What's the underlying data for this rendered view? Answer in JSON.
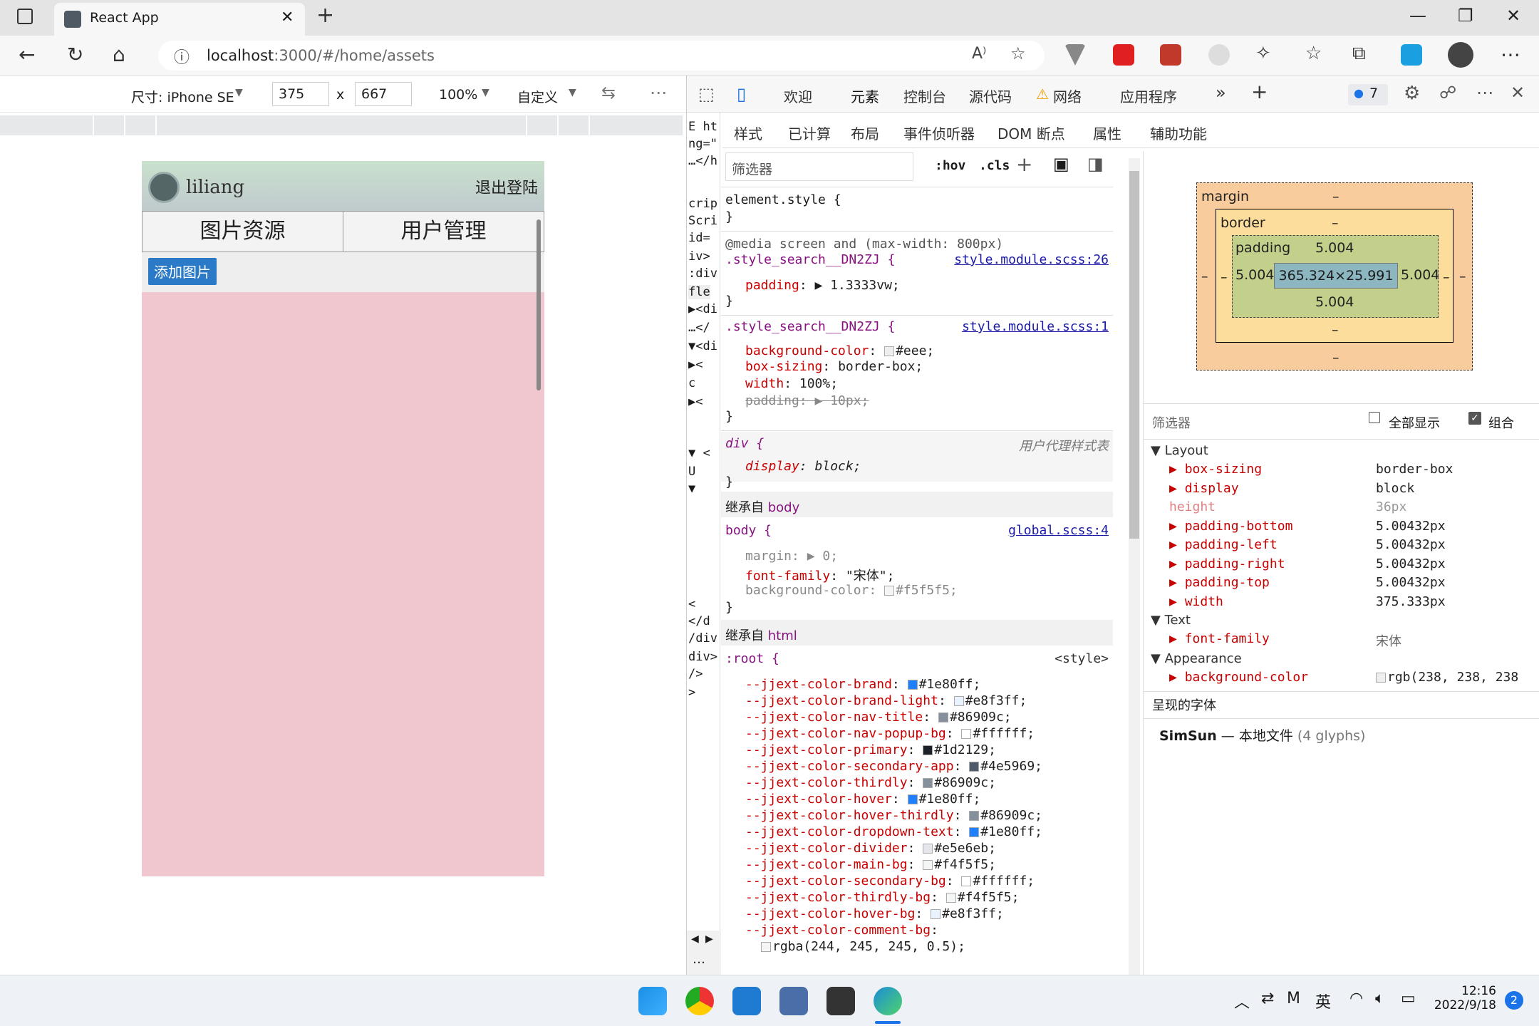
{
  "browser": {
    "tab_title": "React App",
    "tab_close": "✕",
    "new_tab": "+",
    "url_host": "localhost",
    "url_rest": ":3000/#/home/assets"
  },
  "device_toolbar": {
    "device_label": "尺寸: iPhone SE",
    "width": "375",
    "times": "x",
    "height": "667",
    "zoom": "100%",
    "throttle": "自定义",
    "more": "⋯"
  },
  "app": {
    "username": "liliang",
    "logout": "退出登陆",
    "tab_images": "图片资源",
    "tab_users": "用户管理",
    "add_image": "添加图片"
  },
  "devtools": {
    "tabs": [
      "欢迎",
      "元素",
      "控制台",
      "源代码",
      "网络",
      "应用程序"
    ],
    "badge_count": "7",
    "subtabs": [
      "样式",
      "已计算",
      "布局",
      "事件侦听器",
      "DOM 断点",
      "属性",
      "辅助功能"
    ],
    "filter_placeholder": "筛选器",
    "hov": ":hov",
    "cls": ".cls",
    "dom_lines": [
      "E ht",
      "ng=\"",
      "…</h",
      "",
      "crip",
      "Scri",
      " id=",
      "iv>",
      ":div",
      " fle",
      "▶<di",
      " …</",
      "▼<di",
      "  ▶<",
      "   c",
      "  ▶<",
      "",
      "▼ <",
      "   U",
      "  ▼",
      "",
      "",
      "",
      "",
      "   <",
      "  </d",
      " /div",
      "div>",
      "/>",
      ">"
    ],
    "styles": {
      "element_style": "element.style {",
      "close": "}",
      "media": "@media screen and (max-width: 800px)",
      "rule1_sel": ".style_search__DN2ZJ {",
      "rule1_src": "style.module.scss:26",
      "rule1_prop": "padding",
      "rule1_val": "1.3333vw;",
      "rule2_sel": ".style_search__DN2ZJ {",
      "rule2_src": "style.module.scss:1",
      "rule2_props": [
        {
          "p": "background-color",
          "v": "#eee;"
        },
        {
          "p": "box-sizing",
          "v": "border-box;"
        },
        {
          "p": "width",
          "v": "100%;"
        },
        {
          "p": "padding",
          "v": "10px;"
        }
      ],
      "ua_sel": "div {",
      "ua_src": "用户代理样式表",
      "ua_prop": "display",
      "ua_val": "block;",
      "inherited_body_label": "继承自",
      "inherited_body": "body",
      "body_sel": "body {",
      "body_src": "global.scss:4",
      "body_props": [
        {
          "p": "margin",
          "v": "0;"
        },
        {
          "p": "font-family",
          "v": "\"宋体\";"
        },
        {
          "p": "background-color",
          "v": "#f5f5f5;"
        }
      ],
      "inherited_html_label": "继承自",
      "inherited_html": "html",
      "root_sel": ":root {",
      "root_src": "<style>",
      "root_vars": [
        {
          "p": "--jjext-color-brand",
          "v": "#1e80ff;",
          "c": "#1e80ff"
        },
        {
          "p": "--jjext-color-brand-light",
          "v": "#e8f3ff;",
          "c": "#e8f3ff"
        },
        {
          "p": "--jjext-color-nav-title",
          "v": "#86909c;",
          "c": "#86909c"
        },
        {
          "p": "--jjext-color-nav-popup-bg",
          "v": "#ffffff;",
          "c": "#ffffff"
        },
        {
          "p": "--jjext-color-primary",
          "v": "#1d2129;",
          "c": "#1d2129"
        },
        {
          "p": "--jjext-color-secondary-app",
          "v": "#4e5969;",
          "c": "#4e5969"
        },
        {
          "p": "--jjext-color-thirdly",
          "v": "#86909c;",
          "c": "#86909c"
        },
        {
          "p": "--jjext-color-hover",
          "v": "#1e80ff;",
          "c": "#1e80ff"
        },
        {
          "p": "--jjext-color-hover-thirdly",
          "v": "#86909c;",
          "c": "#86909c"
        },
        {
          "p": "--jjext-color-dropdown-text",
          "v": "#1e80ff;",
          "c": "#1e80ff"
        },
        {
          "p": "--jjext-color-divider",
          "v": "#e5e6eb;",
          "c": "#e5e6eb"
        },
        {
          "p": "--jjext-color-main-bg",
          "v": "#f4f5f5;",
          "c": "#f4f5f5"
        },
        {
          "p": "--jjext-color-secondary-bg",
          "v": "#ffffff;",
          "c": "#ffffff"
        },
        {
          "p": "--jjext-color-thirdly-bg",
          "v": "#f4f5f5;",
          "c": "#f4f5f5"
        },
        {
          "p": "--jjext-color-hover-bg",
          "v": "#e8f3ff;",
          "c": "#e8f3ff"
        },
        {
          "p": "--jjext-color-comment-bg",
          "v": "",
          "c": ""
        }
      ],
      "rgba_line": "rgba(244, 245, 245, 0.5);"
    },
    "box_model": {
      "margin_label": "margin",
      "margin_val": "–",
      "border_label": "border",
      "border_val": "–",
      "padding_label": "padding",
      "padding_top": "5.004",
      "padding_left": "5.004",
      "padding_right": "5.004",
      "padding_bottom": "5.004",
      "content": "365.324×25.991",
      "dash": "–"
    },
    "computed": {
      "filter_placeholder": "筛选器",
      "show_all": "全部显示",
      "group": "组合",
      "group_layout": "Layout",
      "layout_props": [
        {
          "p": "box-sizing",
          "v": "border-box"
        },
        {
          "p": "display",
          "v": "block"
        },
        {
          "p": "height",
          "v": "36px"
        },
        {
          "p": "padding-bottom",
          "v": "5.00432px"
        },
        {
          "p": "padding-left",
          "v": "5.00432px"
        },
        {
          "p": "padding-right",
          "v": "5.00432px"
        },
        {
          "p": "padding-top",
          "v": "5.00432px"
        },
        {
          "p": "width",
          "v": "375.333px"
        }
      ],
      "group_text": "Text",
      "text_prop": "font-family",
      "text_val": "宋体",
      "group_appearance": "Appearance",
      "appearance_prop": "background-color",
      "appearance_val": "rgb(238, 238, 238",
      "fonts_title": "呈现的字体",
      "font_name": "SimSun",
      "font_dash": "—",
      "font_source": "本地文件",
      "font_glyphs": "(4 glyphs)"
    }
  },
  "taskbar": {
    "lang": "英",
    "time": "12:16",
    "date": "2022/9/18",
    "notif": "2"
  }
}
